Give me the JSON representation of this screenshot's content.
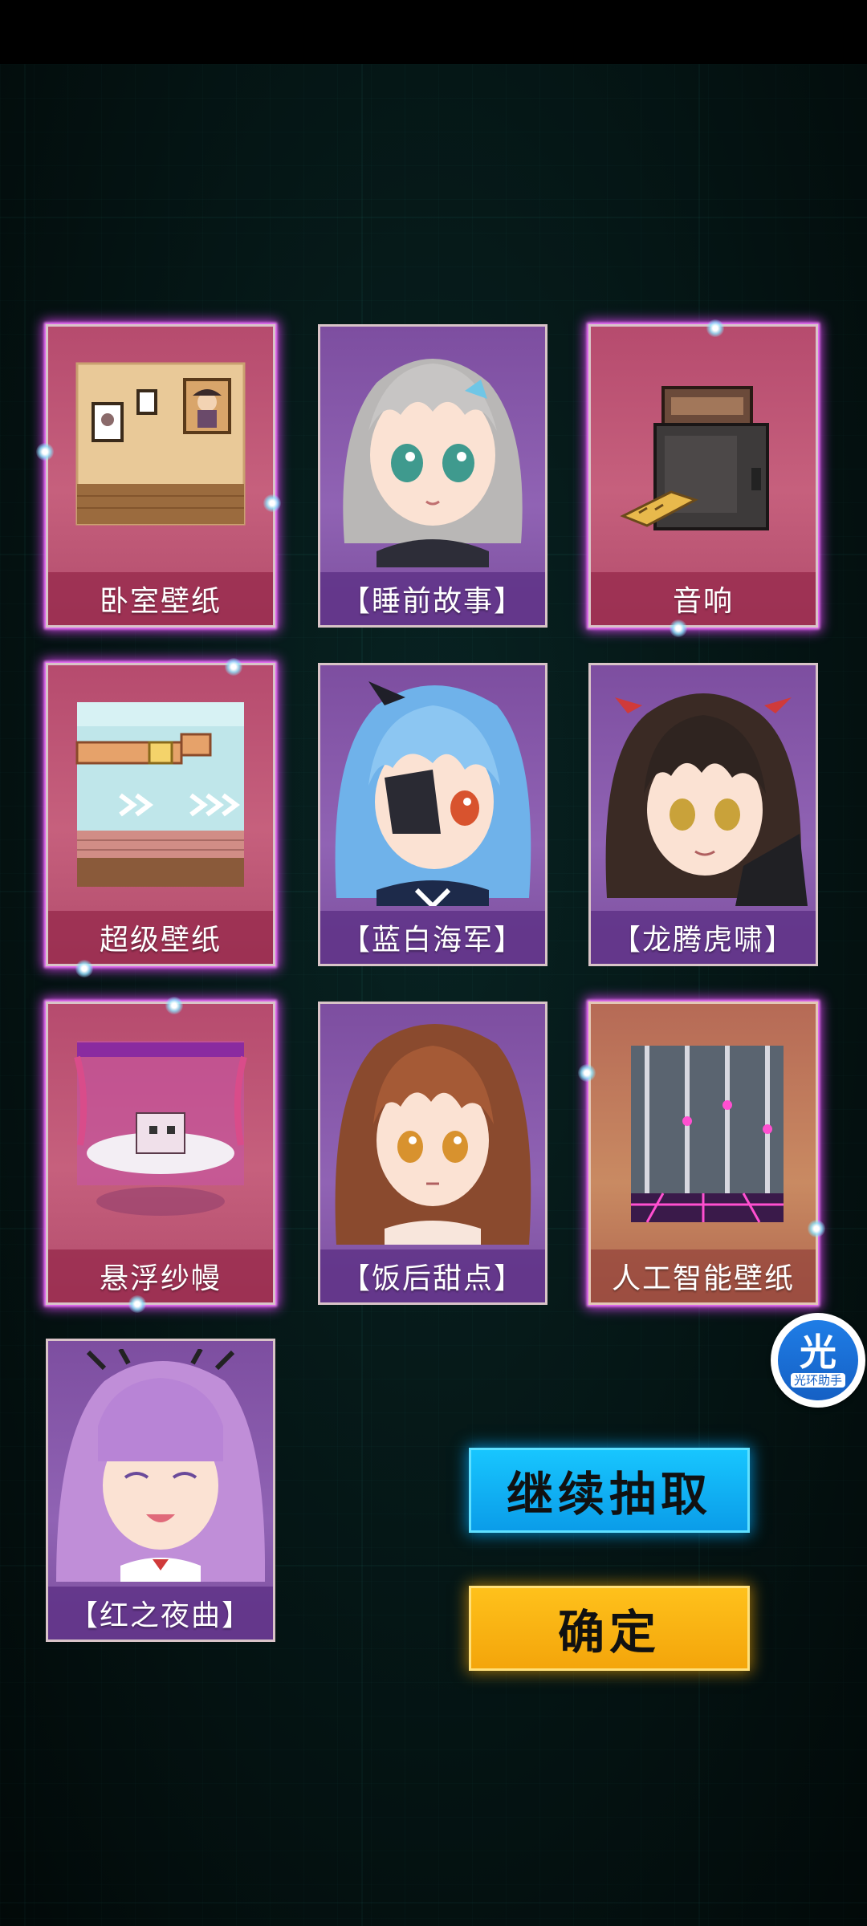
{
  "cards": [
    {
      "label": "卧室壁纸",
      "icon": "bedroom-wallpaper-icon",
      "style": "pink"
    },
    {
      "label": "【睡前故事】",
      "icon": "silver-hair-girl-portrait",
      "style": "purple"
    },
    {
      "label": "音响",
      "icon": "speaker-icon",
      "style": "pink"
    },
    {
      "label": "超级壁纸",
      "icon": "super-wallpaper-icon",
      "style": "pink"
    },
    {
      "label": "【蓝白海军】",
      "icon": "blue-hair-girl-portrait",
      "style": "purple"
    },
    {
      "label": "【龙腾虎啸】",
      "icon": "dark-hair-girl-portrait",
      "style": "purple"
    },
    {
      "label": "悬浮纱幔",
      "icon": "floating-canopy-icon",
      "style": "pink"
    },
    {
      "label": "【饭后甜点】",
      "icon": "brown-hair-girl-portrait",
      "style": "purple"
    },
    {
      "label": "人工智能壁纸",
      "icon": "ai-wallpaper-icon",
      "style": "gold"
    },
    {
      "label": "【红之夜曲】",
      "icon": "lavender-hair-girl-portrait",
      "style": "purple"
    }
  ],
  "buttons": {
    "continue_label": "继续抽取",
    "confirm_label": "确定"
  },
  "assistant": {
    "glyph": "光",
    "name": "光环助手"
  },
  "colors": {
    "continue": "#0a9be8",
    "confirm": "#f3a40a",
    "glow": "#e846ff"
  }
}
